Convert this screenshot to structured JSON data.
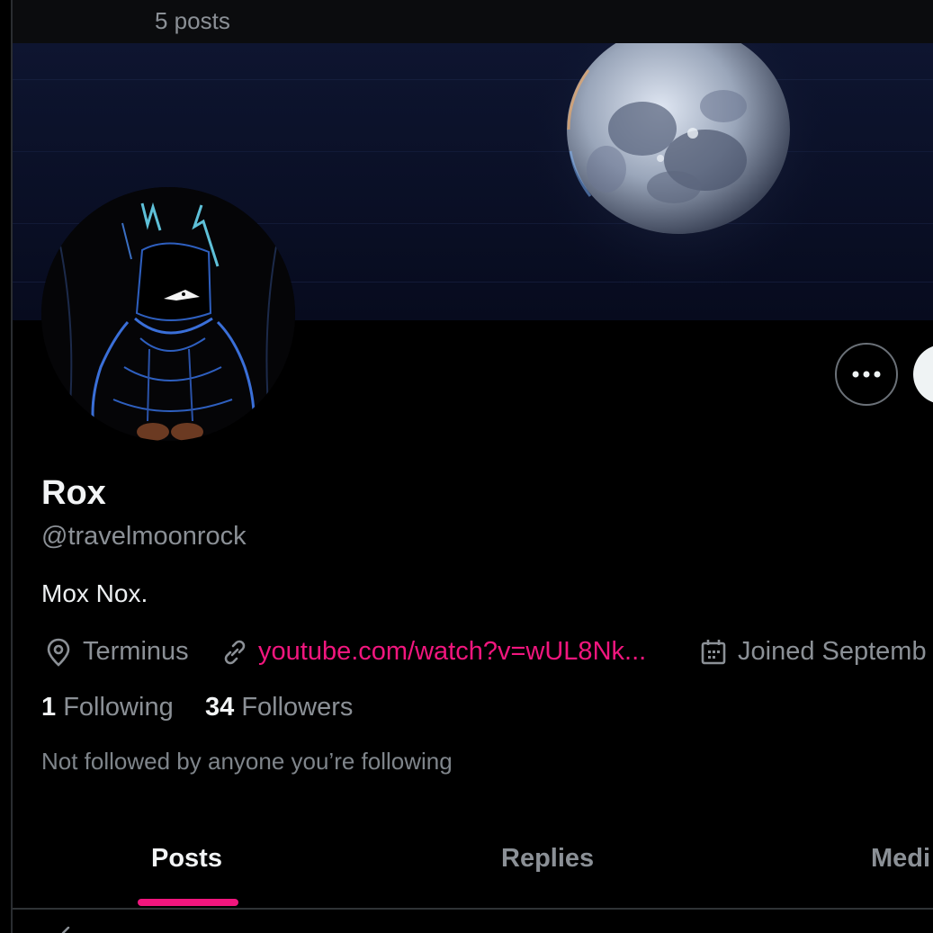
{
  "header": {
    "post_count": "5 posts"
  },
  "profile": {
    "display_name": "Rox",
    "handle": "@travelmoonrock",
    "bio": "Mox Nox.",
    "location": "Terminus",
    "website": "youtube.com/watch?v=wUL8Nk...",
    "joined": "Joined Septemb",
    "following_count": "1",
    "following_label": "Following",
    "followers_count": "34",
    "followers_label": "Followers",
    "mutuals_note": "Not followed by anyone you’re following"
  },
  "tabs": [
    {
      "label": "Posts",
      "active": true
    },
    {
      "label": "Replies",
      "active": false
    },
    {
      "label": "Medi",
      "active": false
    }
  ],
  "icons": {
    "back": "arrow-left-icon",
    "more": "more-dots-icon",
    "location": "location-pin-icon",
    "link": "link-icon",
    "calendar": "calendar-icon"
  },
  "colors": {
    "background": "#000000",
    "accent": "#f1167e",
    "muted_text": "#8b9096",
    "primary_text": "#f2f4f5",
    "divider": "#2f3336"
  }
}
